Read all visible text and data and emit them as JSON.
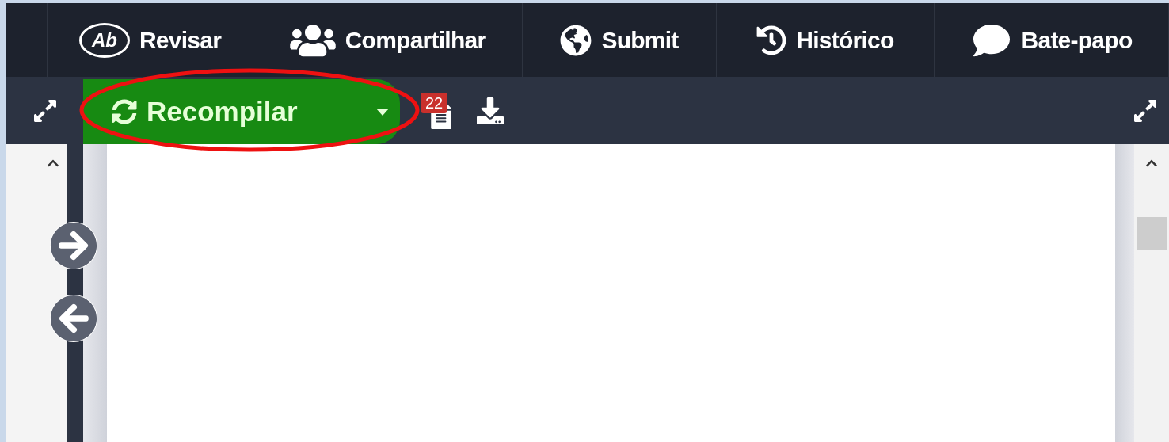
{
  "top_nav": [
    {
      "kind": "review",
      "icon_text": "Ab",
      "label": "Revisar"
    },
    {
      "kind": "share",
      "label": "Compartilhar"
    },
    {
      "kind": "submit",
      "label": "Submit"
    },
    {
      "kind": "history",
      "label": "Histórico"
    },
    {
      "kind": "chat",
      "label": "Bate-papo"
    }
  ],
  "toolbar": {
    "recompile": {
      "label": "Recompilar",
      "highlighted": true
    },
    "logs_badge": "22"
  }
}
